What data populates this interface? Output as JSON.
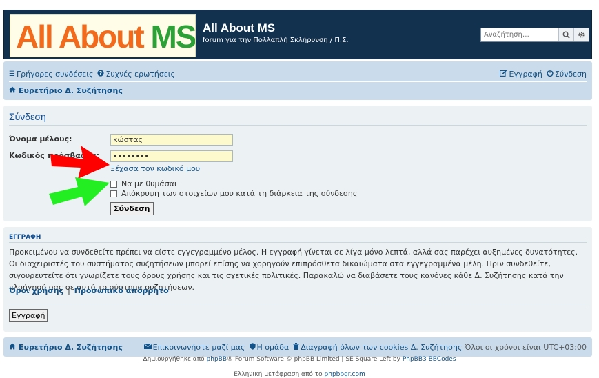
{
  "header": {
    "logo_part1": "All About ",
    "logo_part2": "MS",
    "site_title": "All About MS",
    "site_description": "forum για την Πολλαπλή Σκλήρυνση / Π.Σ.",
    "search_placeholder": "Αναζήτηση…"
  },
  "nav": {
    "quick_links": "Γρήγορες συνδέσεις",
    "faq": "Συχνές ερωτήσεις",
    "register": "Εγγραφή",
    "login": "Σύνδεση",
    "breadcrumb": "Ευρετήριο Δ. Συζήτησης"
  },
  "login": {
    "title": "Σύνδεση",
    "username_label": "Όνομα μέλους:",
    "username_value": "κώστας",
    "password_label": "Κωδικός πρόσβασης:",
    "password_value": "••••••••",
    "forgot_link": "Ξέχασα τον κωδικό μου",
    "remember_label": "Να με θυμάσαι",
    "hide_label": "Απόκρυψη των στοιχείων μου κατά τη διάρκεια της σύνδεσης",
    "submit_label": "Σύνδεση"
  },
  "register": {
    "heading": "ΕΓΓΡΑΦΗ",
    "text": "Προκειμένου να συνδεθείτε πρέπει να είστε εγγεγραμμένο μέλος. Η εγγραφή γίνεται σε λίγα μόνο λεπτά, αλλά σας παρέχει αυξημένες δυνατότητες. Οι διαχειριστές του συστήματος συζητήσεων μπορεί επίσης να χορηγούν επιπρόσθετα δικαιώματα στα εγγεγραμμένα μέλη. Πριν συνδεθείτε, σιγουρευτείτε ότι γνωρίζετε τους όρους χρήσης και τις σχετικές πολιτικές. Παρακαλώ να διαβάσετε τους κανόνες κάθε Δ. Συζήτησης κατά την πλοήγησή σας σε αυτό το σύστημα συζητήσεων.",
    "terms": "Όροι χρήσης",
    "separator": "|",
    "privacy": "Προσωπικό απόρρητο",
    "button": "Εγγραφή"
  },
  "footer_nav": {
    "breadcrumb": "Ευρετήριο Δ. Συζήτησης",
    "contact": "Επικοινωνήστε μαζί μας",
    "team": "Η ομάδα",
    "delete_cookies": "Διαγραφή όλων των cookies Δ. Συζήτησης",
    "timezone": "Όλοι οι χρόνοι είναι UTC+03:00"
  },
  "credits": {
    "powered_prefix": "Δημιουργήθηκε από ",
    "phpbb_link": "phpBB",
    "powered_suffix": "® Forum Software © phpBB Limited | SE Square Left by ",
    "bbcodes_link": "PhpBB3 BBCodes",
    "translation_prefix": "Ελληνική μετάφραση από το ",
    "translation_link": "phpbbgr.com"
  },
  "colors": {
    "header_bg": "#12314f",
    "nav_bg": "#cadceb",
    "panel_bg": "#ecf1f3",
    "link": "#105289",
    "field_bg": "#fdfbcd",
    "arrow_red": "#ff0000",
    "arrow_green": "#22ee22"
  }
}
